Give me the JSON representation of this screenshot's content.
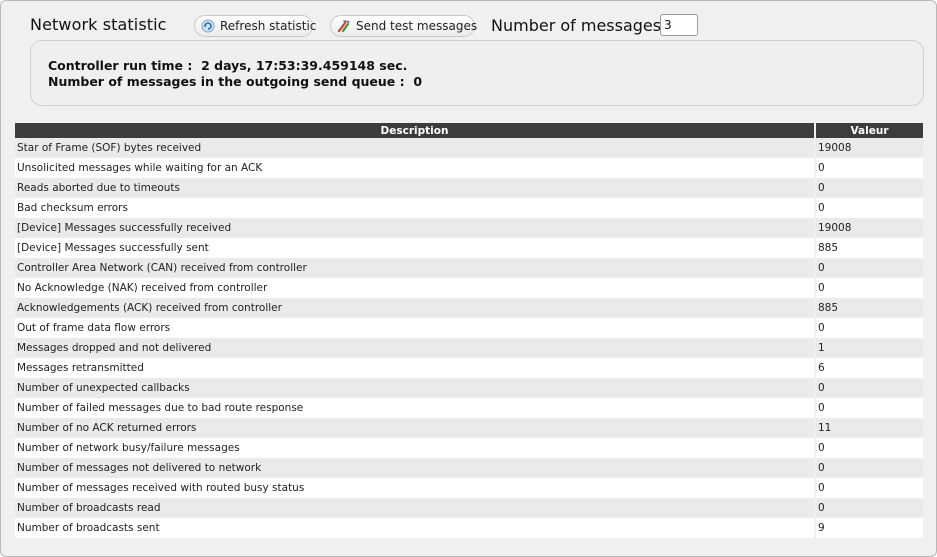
{
  "header": {
    "title": "Network statistic",
    "refresh_label": "Refresh statistic",
    "send_label": "Send test messages",
    "msg_count_label": "Number of messages",
    "msg_count_value": "3"
  },
  "info": {
    "runtime": "Controller run time :  2 days, 17:53:39.459148 sec.",
    "queue": "Number of messages in the outgoing send queue :  0"
  },
  "table": {
    "headers": [
      "Description",
      "Valeur"
    ],
    "rows": [
      {
        "desc": "Star of Frame (SOF) bytes received",
        "value": "19008"
      },
      {
        "desc": "Unsolicited messages while waiting for an ACK",
        "value": "0"
      },
      {
        "desc": "Reads aborted due to timeouts",
        "value": "0"
      },
      {
        "desc": "Bad checksum errors",
        "value": "0"
      },
      {
        "desc": "[Device] Messages successfully received",
        "value": "19008"
      },
      {
        "desc": "[Device] Messages successfully sent",
        "value": "885"
      },
      {
        "desc": "Controller Area Network (CAN) received from controller",
        "value": "0"
      },
      {
        "desc": "No Acknowledge (NAK) received from controller",
        "value": "0"
      },
      {
        "desc": "Acknowledgements (ACK) received from controller",
        "value": "885"
      },
      {
        "desc": "Out of frame data flow errors",
        "value": "0"
      },
      {
        "desc": "Messages dropped and not delivered",
        "value": "1"
      },
      {
        "desc": "Messages retransmitted",
        "value": "6"
      },
      {
        "desc": "Number of unexpected callbacks",
        "value": "0"
      },
      {
        "desc": "Number of failed messages due to bad route response",
        "value": "0"
      },
      {
        "desc": "Number of no ACK returned errors",
        "value": "11"
      },
      {
        "desc": "Number of network busy/failure messages",
        "value": "0"
      },
      {
        "desc": "Number of messages not delivered to network",
        "value": "0"
      },
      {
        "desc": "Number of messages received with routed busy status",
        "value": "0"
      },
      {
        "desc": "Number of broadcasts read",
        "value": "0"
      },
      {
        "desc": "Number of broadcasts sent",
        "value": "9"
      }
    ]
  },
  "icons": {
    "refresh": "refresh-icon",
    "send": "send-test-icon"
  },
  "colors": {
    "header_bg": "#3c3c3c",
    "panel_bg": "#f0f0f0",
    "row_alt": "#eaeaea"
  }
}
